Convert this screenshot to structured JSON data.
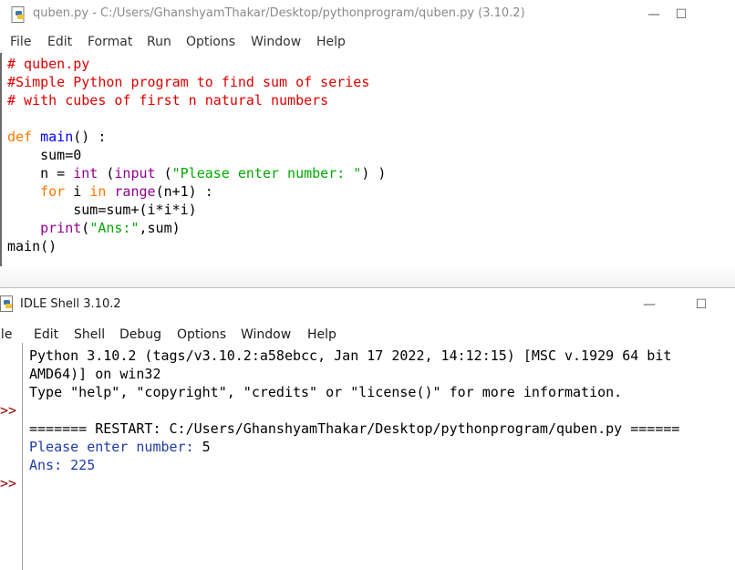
{
  "editor": {
    "title": "quben.py - C:/Users/GhanshyamThakar/Desktop/pythonprogram/quben.py (3.10.2)",
    "menu": [
      "File",
      "Edit",
      "Format",
      "Run",
      "Options",
      "Window",
      "Help"
    ],
    "code": {
      "l1": "# quben.py",
      "l2": "#Simple Python program to find sum of series",
      "l3": "# with cubes of first n natural numbers",
      "def_kw": "def",
      "func_name": "main",
      "def_rest": "() :",
      "l6": "    sum=0",
      "l7_a": "    n = ",
      "l7_int": "int",
      "l7_b": " (",
      "l7_input": "input",
      "l7_c": " (",
      "l7_str": "\"Please enter number: \"",
      "l7_d": ") )",
      "l8_indent": "    ",
      "for_kw": "for",
      "l8_a": " i ",
      "in_kw": "in",
      "l8_b": " ",
      "range_bi": "range",
      "l8_c": "(n+1) :",
      "l9": "        sum=sum+(i*i*i)",
      "l10_indent": "    ",
      "print_bi": "print",
      "l10_a": "(",
      "l10_str": "\"Ans:\"",
      "l10_b": ",sum)",
      "l11": "main()"
    }
  },
  "shell": {
    "title": "IDLE Shell 3.10.2",
    "menu": [
      "File",
      "Edit",
      "Shell",
      "Debug",
      "Options",
      "Window",
      "Help"
    ],
    "prompt": ">>",
    "lines": {
      "banner1": "Python 3.10.2 (tags/v3.10.2:a58ebcc, Jan 17 2022, 14:12:15) [MSC v.1929 64 bit",
      "banner2": "AMD64)] on win32",
      "banner3": "Type \"help\", \"copyright\", \"credits\" or \"license()\" for more information.",
      "restart": "======= RESTART: C:/Users/GhanshyamThakar/Desktop/pythonprogram/quben.py ======",
      "input_prompt": "Please enter number: ",
      "input_value": "5",
      "answer": "Ans: 225"
    }
  },
  "window_buttons": {
    "minimize": "—",
    "maximize": "☐",
    "close": "✕"
  },
  "colors": {
    "comment": "#dd0000",
    "keyword": "#ff7700",
    "builtin": "#900090",
    "string": "#00aa00",
    "definition": "#0000ff",
    "stdout": "#1e3ba8"
  }
}
